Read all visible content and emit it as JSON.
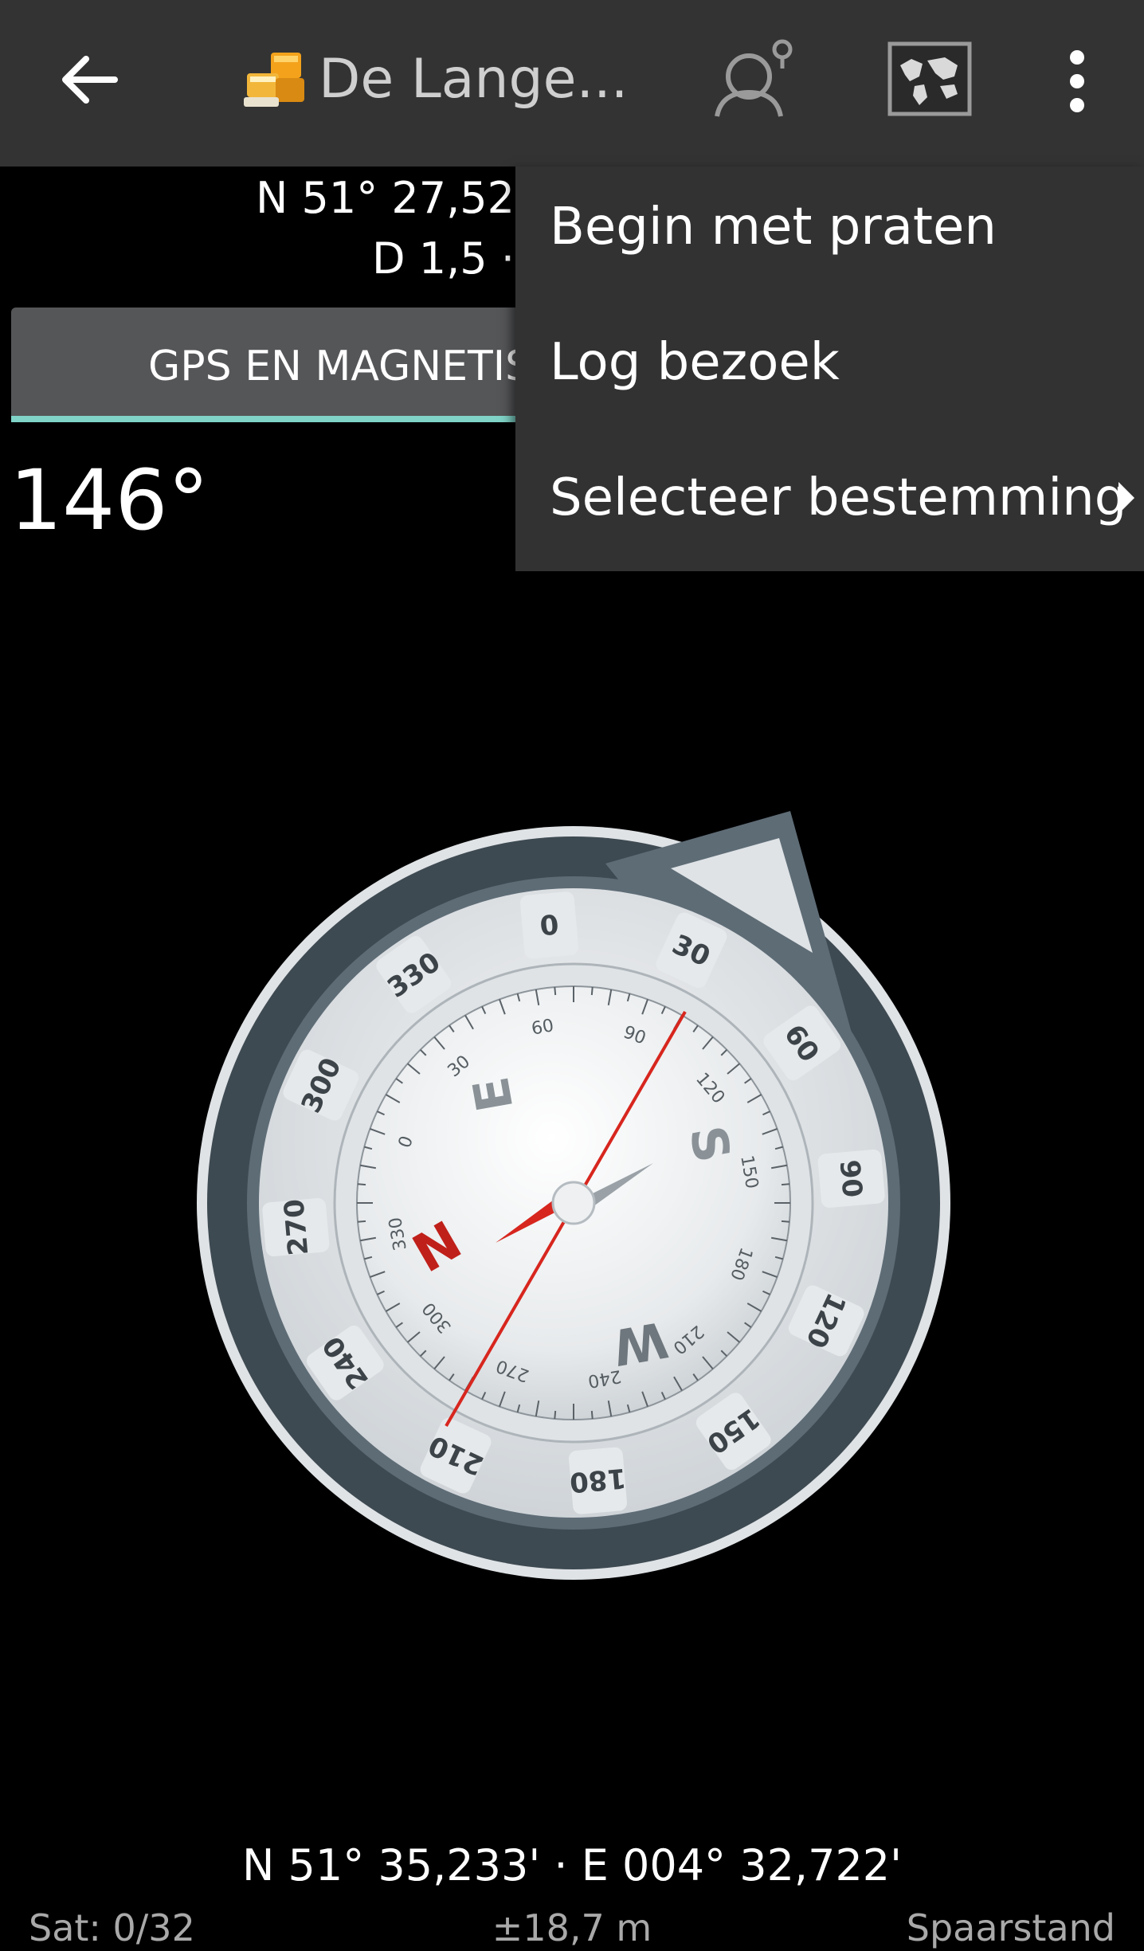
{
  "appbar": {
    "title": "De Lange...",
    "back_icon": "arrow-left-icon",
    "logo_icon": "geocache-logo-icon",
    "user_hint_icon": "user-hint-icon",
    "map_icon": "map-icon",
    "more_icon": "more-vert-icon"
  },
  "target": {
    "coord_line1": "N 51° 27,52",
    "coord_line2": "D 1,5 ·"
  },
  "tabs": {
    "active_label": "GPS EN MAGNETIS"
  },
  "heading": "146°",
  "menu": {
    "items": [
      {
        "label": "Begin met praten"
      },
      {
        "label": "Log bezoek"
      },
      {
        "label": "Selecteer bestemming",
        "has_submenu": true
      }
    ]
  },
  "compass": {
    "outer_ticks": [
      "330",
      "0",
      "30",
      "60",
      "90",
      "120",
      "150",
      "180",
      "210",
      "240",
      "270",
      "300"
    ],
    "inner_ticks": [
      "0",
      "30",
      "60",
      "90",
      "120",
      "150",
      "180",
      "210",
      "240",
      "270",
      "300",
      "330"
    ],
    "cardinals": {
      "n": "N",
      "e": "E",
      "s": "S",
      "w": "W"
    },
    "colors": {
      "needle_red": "#d7261e",
      "bezel": "#5e6c76"
    }
  },
  "footer": {
    "position": "N 51° 35,233' · E 004° 32,722'",
    "satellites": "Sat: 0/32",
    "accuracy": "±18,7 m",
    "mode": "Spaarstand"
  }
}
